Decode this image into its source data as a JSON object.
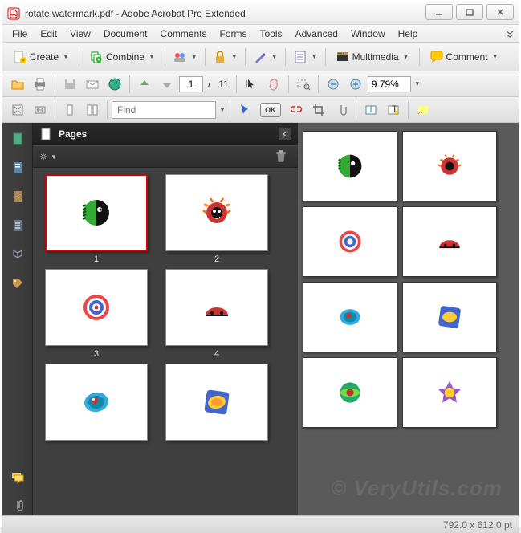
{
  "window": {
    "title": "rotate.watermark.pdf - Adobe Acrobat Pro Extended"
  },
  "menu": {
    "file": "File",
    "edit": "Edit",
    "view": "View",
    "document": "Document",
    "comments": "Comments",
    "forms": "Forms",
    "tools": "Tools",
    "advanced": "Advanced",
    "window": "Window",
    "help": "Help"
  },
  "toolbar": {
    "create": "Create",
    "combine": "Combine",
    "multimedia": "Multimedia",
    "comment": "Comment",
    "page_current": "1",
    "page_sep": "/",
    "page_total": "11",
    "zoom": "9.79%",
    "find_placeholder": "Find",
    "ok": "OK"
  },
  "panel": {
    "title": "Pages",
    "thumbs": [
      "1",
      "2",
      "3",
      "4"
    ]
  },
  "status": {
    "dims": "792.0 x 612.0 pt"
  },
  "watermark": "© VeryUtils.com"
}
